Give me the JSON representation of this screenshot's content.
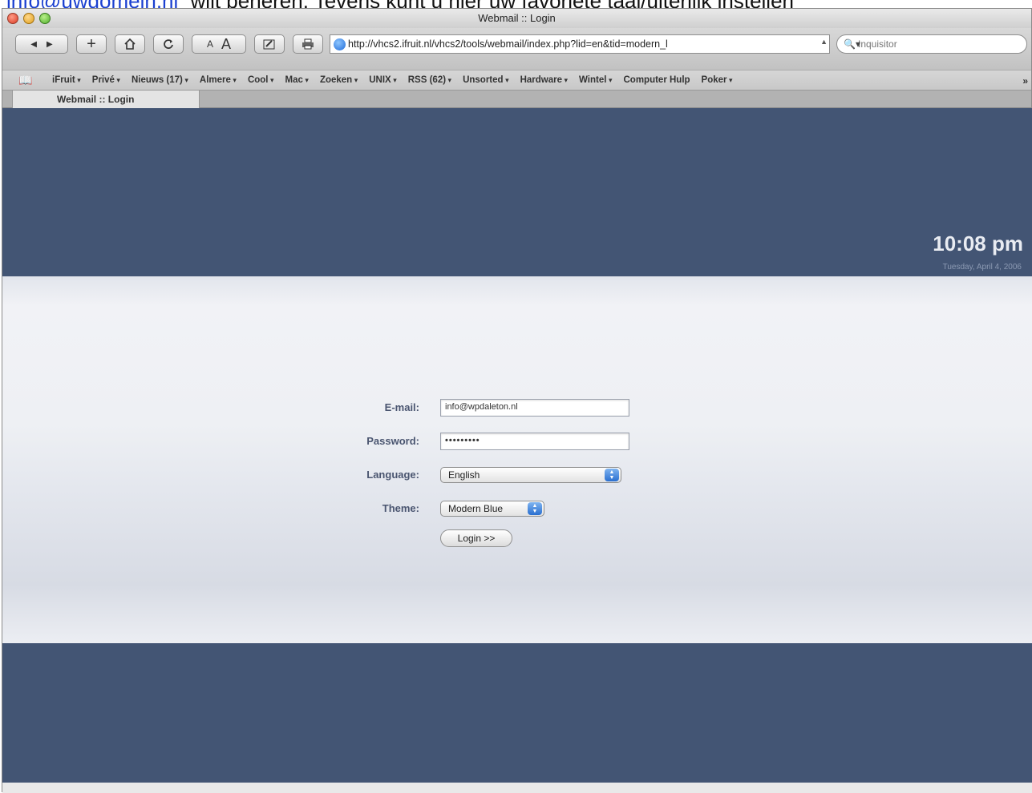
{
  "caption": {
    "link_text": "info@uwdomein.nl",
    "rest_text": "wilt beheren. Tevens kunt u hier uw favoriete taal/uiterlijk instellen"
  },
  "window": {
    "title": "Webmail :: Login"
  },
  "toolbar": {
    "back_icon": "back-arrow-icon",
    "forward_icon": "forward-arrow-icon",
    "add_label": "+",
    "home_icon": "house-icon",
    "reload_icon": "reload-icon",
    "text_smaller_label": "A",
    "text_larger_label": "A",
    "url": "http://vhcs2.ifruit.nl/vhcs2/tools/webmail/index.php?lid=en&tid=modern_l",
    "search_placeholder": "Inquisitor"
  },
  "bookmarks": {
    "items": [
      "iFruit",
      "Privé",
      "Nieuws (17)",
      "Almere",
      "Cool",
      "Mac",
      "Zoeken",
      "UNIX",
      "RSS (62)",
      "Unsorted",
      "Hardware",
      "Wintel",
      "Computer Hulp",
      "Poker"
    ],
    "more_label": "»"
  },
  "tabs": {
    "active_label": "Webmail :: Login"
  },
  "header": {
    "time": "10:08 pm",
    "date": "Tuesday, April 4, 2006"
  },
  "form": {
    "email_label": "E-mail:",
    "email_value": "info@wpdaleton.nl",
    "password_label": "Password:",
    "password_value": "•••••••••",
    "language_label": "Language:",
    "language_value": "English",
    "theme_label": "Theme:",
    "theme_value": "Modern Blue",
    "login_label": "Login >>"
  },
  "colors": {
    "band": "#435574",
    "label": "#4a5570",
    "link": "#1a3fd0"
  }
}
